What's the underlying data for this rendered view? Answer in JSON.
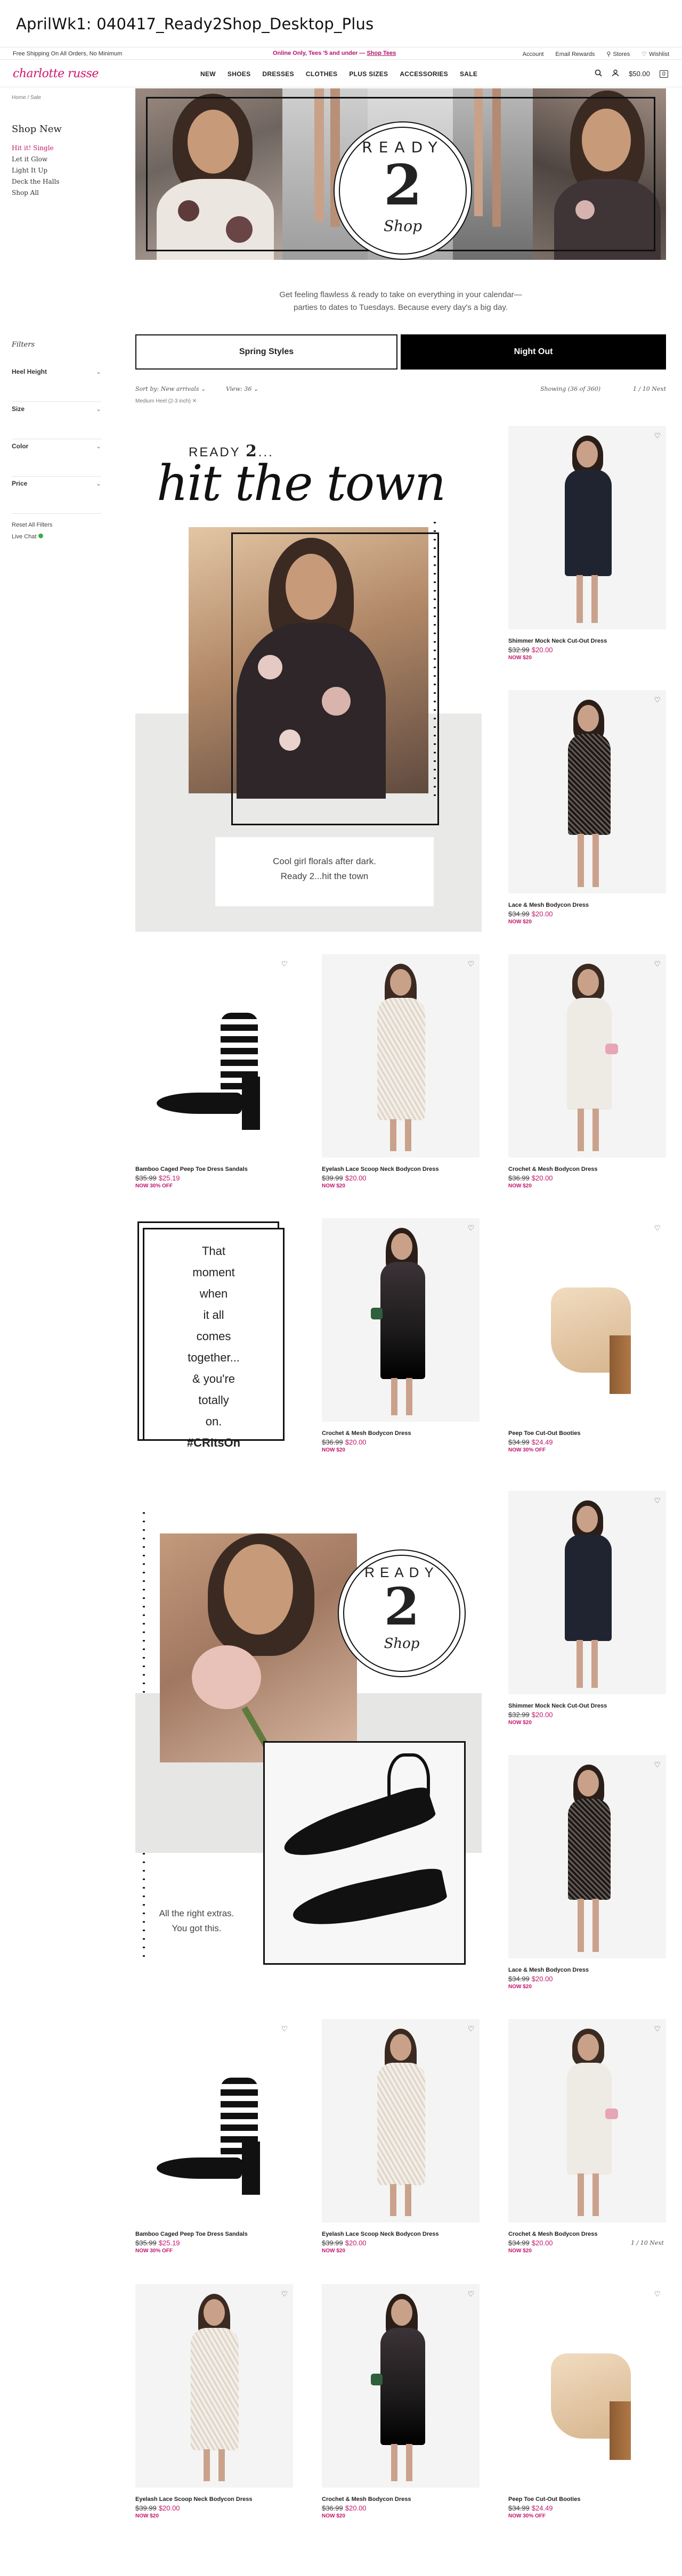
{
  "doc_title": "AprilWk1: 040417_Ready2Shop_Desktop_Plus",
  "promo": {
    "left": "Free Shipping On All Orders, No Minimum",
    "center_text": "Online Only, Tees '5 and under — ",
    "center_link": "Shop Tees",
    "account": "Account",
    "rewards": "Email Rewards",
    "stores": "Stores",
    "wishlist": "Wishlist"
  },
  "header": {
    "logo": "charlotte russe",
    "nav": [
      "NEW",
      "SHOES",
      "DRESSES",
      "CLOTHES",
      "PLUS SIZES",
      "ACCESSORIES",
      "SALE"
    ],
    "search_icon": "search-icon",
    "user_icon": "user-icon",
    "price": "$50.00",
    "bag_count": "0"
  },
  "breadcrumb": "Home / Sale",
  "sidebar": {
    "heading": "Shop New",
    "links": [
      "Hit it! Single",
      "Let it Glow",
      "Light It Up",
      "Deck the Halls",
      "Shop All"
    ],
    "filters_title": "Filters",
    "filters": [
      "Heel Height",
      "Size",
      "Color",
      "Price"
    ],
    "reset": "Reset All Filters",
    "live_chat": "Live Chat"
  },
  "hero": {
    "ready": "READY",
    "two": "2",
    "shop": "Shop"
  },
  "tagline": {
    "line1": "Get feeling flawless & ready to take on everything in your calendar—",
    "line2": "parties to dates to Tuesdays. Because every day's a big day."
  },
  "segments": {
    "spring": "Spring Styles",
    "night": "Night Out"
  },
  "sortbar": {
    "sort": "Sort by:  New arrivals  ⌄",
    "view": "View:  36  ⌄",
    "showing": "Showing (36 of 360)",
    "pager": "1 / 10   Next",
    "selected": "Medium Heel (2-3 inch)  ✕"
  },
  "hit": {
    "ready": "READY",
    "two": "2",
    "ellipsis": "...",
    "script": "hit the town",
    "cap1": "Cool girl florals after dark.",
    "cap2": "Ready 2...hit the town"
  },
  "products": [
    {
      "name": "Shimmer Mock Neck Cut-Out Dress",
      "old": "$32.99",
      "new": "$20.00",
      "promo": "NOW $20"
    },
    {
      "name": "Lace & Mesh Bodycon Dress",
      "old": "$34.99",
      "new": "$20.00",
      "promo": "NOW $20"
    },
    {
      "name": "Bamboo Caged Peep Toe Dress Sandals",
      "old": "$35.99",
      "new": "$25.19",
      "promo": "NOW 30% OFF"
    },
    {
      "name": "Eyelash Lace Scoop Neck Bodycon Dress",
      "old": "$39.99",
      "new": "$20.00",
      "promo": "NOW $20"
    },
    {
      "name": "Crochet & Mesh Bodycon Dress",
      "old": "$36.99",
      "new": "$20.00",
      "promo": "NOW $20"
    },
    {
      "name": "Crochet & Mesh Bodycon Dress",
      "old": "$36.99",
      "new": "$20.00",
      "promo": "NOW $20"
    },
    {
      "name": "Peep Toe Cut-Out Booties",
      "old": "$34.99",
      "new": "$24.49",
      "promo": "NOW 30% OFF"
    },
    {
      "name": "Shimmer Mock Neck Cut-Out Dress",
      "old": "$32.99",
      "new": "$20.00",
      "promo": "NOW $20"
    },
    {
      "name": "Lace & Mesh Bodycon Dress",
      "old": "$34.99",
      "new": "$20.00",
      "promo": "NOW $20"
    },
    {
      "name": "Bamboo Caged Peep Toe Dress Sandals",
      "old": "$35.99",
      "new": "$25.19",
      "promo": "NOW 30% OFF"
    },
    {
      "name": "Eyelash Lace Scoop Neck Bodycon Dress",
      "old": "$39.99",
      "new": "$20.00",
      "promo": "NOW $20"
    },
    {
      "name": "Crochet & Mesh Bodycon Dress",
      "old": "$34.99",
      "new": "$20.00",
      "promo": "NOW $20"
    },
    {
      "name": "Eyelash Lace Scoop Neck Bodycon Dress",
      "old": "$39.99",
      "new": "$20.00",
      "promo": "NOW $20"
    },
    {
      "name": "Crochet & Mesh Bodycon Dress",
      "old": "$36.99",
      "new": "$20.00",
      "promo": "NOW $20"
    },
    {
      "name": "Peep Toe Cut-Out Booties",
      "old": "$34.99",
      "new": "$24.49",
      "promo": "NOW 30% OFF"
    }
  ],
  "quote": {
    "lines": [
      "That",
      "moment",
      "when",
      "it all",
      "comes",
      "together...",
      "& you're",
      "totally",
      "on."
    ],
    "hashtag": "#CRItsOn"
  },
  "ready2": {
    "ready": "READY",
    "two": "2",
    "shop": "Shop",
    "extras1": "All the right extras.",
    "extras2": "You got this."
  },
  "pager_bottom": "1 / 10   Next",
  "colors": {
    "brand": "#d1156f",
    "sale": "#c2186d"
  }
}
